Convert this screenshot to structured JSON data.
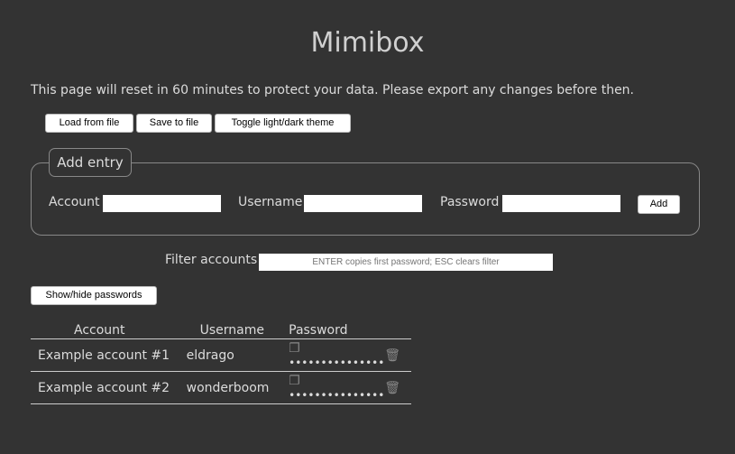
{
  "title": "Mimibox",
  "notice": "This page will reset in 60 minutes to protect your data. Please export any changes before then.",
  "toolbar": {
    "load": "Load from file",
    "save": "Save to file",
    "theme": "Toggle light/dark theme"
  },
  "add_entry": {
    "legend": "Add entry",
    "account_label": "Account",
    "username_label": "Username",
    "password_label": "Password",
    "account_value": "",
    "username_value": "",
    "password_value": "",
    "add": "Add"
  },
  "filter": {
    "label": "Filter accounts",
    "placeholder": "ENTER copies first password; ESC clears filter",
    "value": ""
  },
  "show_hide": "Show/hide passwords",
  "table": {
    "headers": [
      "Account",
      "Username",
      "Password"
    ],
    "rows": [
      {
        "account": "Example account #1",
        "username": "eldrago",
        "password": "•••••••••••••••"
      },
      {
        "account": "Example account #2",
        "username": "wonderboom",
        "password": "•••••••••••••••"
      }
    ]
  }
}
